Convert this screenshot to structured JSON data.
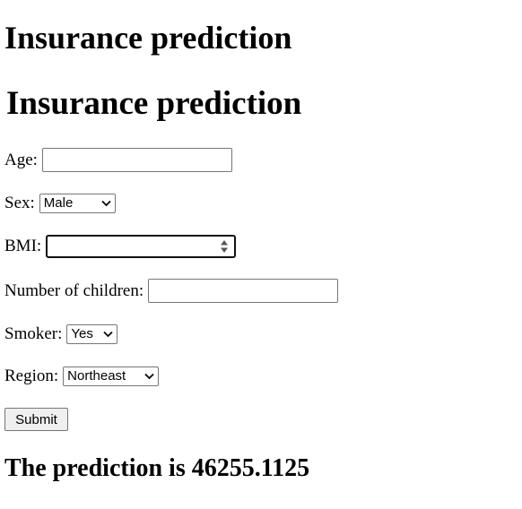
{
  "page": {
    "headings": [
      "Insurance prediction",
      "Insurance prediction"
    ]
  },
  "form": {
    "age": {
      "label": "Age:",
      "value": ""
    },
    "sex": {
      "label": "Sex:",
      "selected": "Male"
    },
    "bmi": {
      "label": "BMI:",
      "value": ""
    },
    "children": {
      "label": "Number of children:",
      "value": ""
    },
    "smoker": {
      "label": "Smoker:",
      "selected": "Yes"
    },
    "region": {
      "label": "Region:",
      "selected": "Northeast"
    },
    "submit_label": "Submit"
  },
  "result": {
    "text": "The prediction is 46255.1125"
  },
  "icons": {
    "dropdown": "chevron-down-icon",
    "spinner": "spinner-arrows-icon"
  }
}
